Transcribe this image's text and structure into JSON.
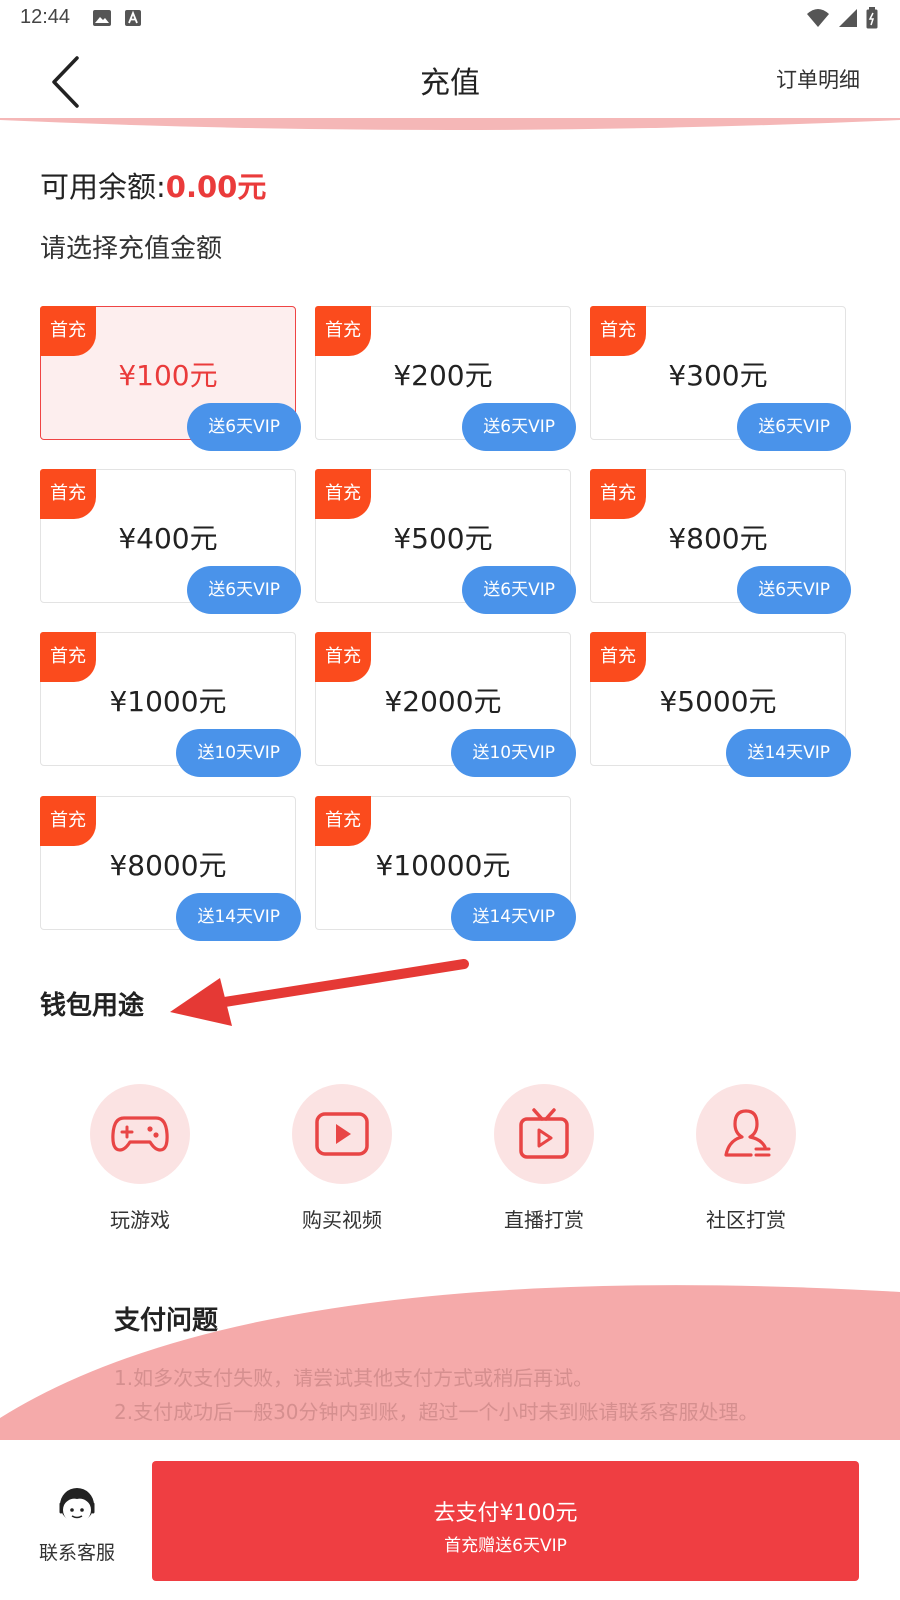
{
  "status_bar": {
    "time": "12:44"
  },
  "header": {
    "title": "充值",
    "order_detail": "订单明细"
  },
  "balance": {
    "label": "可用余额:",
    "amount": "0.00元"
  },
  "select_label": "请选择充值金额",
  "options": [
    {
      "tag": "首充",
      "price": "¥100元",
      "bonus": "送6天VIP",
      "selected": true
    },
    {
      "tag": "首充",
      "price": "¥200元",
      "bonus": "送6天VIP"
    },
    {
      "tag": "首充",
      "price": "¥300元",
      "bonus": "送6天VIP"
    },
    {
      "tag": "首充",
      "price": "¥400元",
      "bonus": "送6天VIP"
    },
    {
      "tag": "首充",
      "price": "¥500元",
      "bonus": "送6天VIP"
    },
    {
      "tag": "首充",
      "price": "¥800元",
      "bonus": "送6天VIP"
    },
    {
      "tag": "首充",
      "price": "¥1000元",
      "bonus": "送10天VIP"
    },
    {
      "tag": "首充",
      "price": "¥2000元",
      "bonus": "送10天VIP"
    },
    {
      "tag": "首充",
      "price": "¥5000元",
      "bonus": "送14天VIP"
    },
    {
      "tag": "首充",
      "price": "¥8000元",
      "bonus": "送14天VIP"
    },
    {
      "tag": "首充",
      "price": "¥10000元",
      "bonus": "送14天VIP"
    }
  ],
  "wallet": {
    "title": "钱包用途",
    "uses": [
      {
        "label": "玩游戏",
        "icon": "gamepad-icon"
      },
      {
        "label": "购买视频",
        "icon": "play-video-icon"
      },
      {
        "label": "直播打赏",
        "icon": "tv-live-icon"
      },
      {
        "label": "社区打赏",
        "icon": "community-user-icon"
      }
    ]
  },
  "payment": {
    "title": "支付问题",
    "notes": [
      "1.如多次支付失败，请尝试其他支付方式或稍后再试。",
      "2.支付成功后一般30分钟内到账，超过一个小时未到账请联系客服处理。"
    ]
  },
  "bottom": {
    "service_label": "联系客服",
    "pay_main": "去支付¥100元",
    "pay_sub": "首充赠送6天VIP"
  },
  "colors": {
    "accent": "#ef3e42",
    "vip_blue": "#4a93ea",
    "tag_orange": "#fb4b1d",
    "pink_bg": "#f5aaaa",
    "icon_circle": "#fbe3e3"
  }
}
